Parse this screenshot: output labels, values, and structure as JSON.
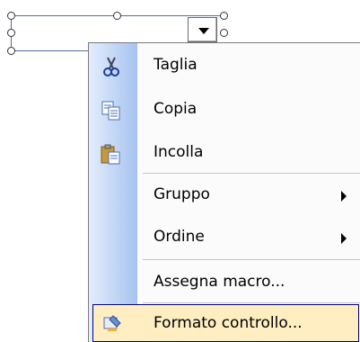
{
  "menu": {
    "items": [
      {
        "id": "cut",
        "label": "Taglia",
        "icon": "scissors-icon"
      },
      {
        "id": "copy",
        "label": "Copia",
        "icon": "copy-icon"
      },
      {
        "id": "paste",
        "label": "Incolla",
        "icon": "paste-icon"
      },
      {
        "id": "group",
        "label": "Gruppo",
        "icon": null,
        "submenu": true
      },
      {
        "id": "order",
        "label": "Ordine",
        "icon": null,
        "submenu": true
      },
      {
        "id": "assign-macro",
        "label": "Assegna macro...",
        "icon": null
      },
      {
        "id": "format-control",
        "label": "Formato controllo...",
        "icon": "format-control-icon",
        "highlighted": true
      }
    ]
  },
  "colors": {
    "highlight": "#ffeec2",
    "highlight_border": "#000080",
    "gutter_start": "#e3eefc",
    "gutter_end": "#a6c2ef"
  }
}
